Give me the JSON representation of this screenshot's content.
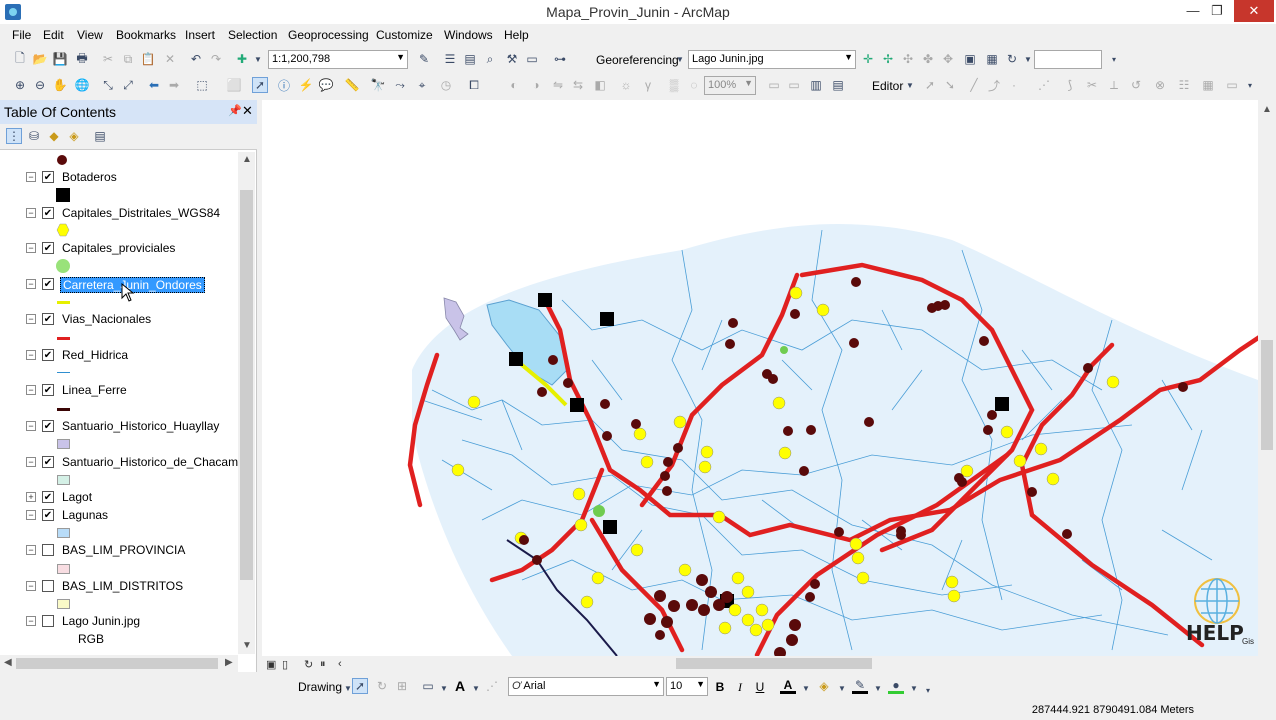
{
  "window": {
    "title": "Mapa_Provin_Junin - ArcMap",
    "minimize": "—",
    "restore": "❐",
    "close": "✕"
  },
  "menu": [
    "File",
    "Edit",
    "View",
    "Bookmarks",
    "Insert",
    "Selection",
    "Geoprocessing",
    "Customize",
    "Windows",
    "Help"
  ],
  "toolbar": {
    "scale": "1:1,200,798",
    "georeferencing_label": "Georeferencing",
    "georef_layer": "Lago Junin.jpg",
    "georef_extra": "",
    "editor_label": "Editor",
    "transparency": "100%"
  },
  "toc": {
    "title": "Table Of Contents",
    "layers": [
      {
        "name": "Botaderos",
        "checked": true,
        "symbol": "black-square"
      },
      {
        "name": "Capitales_Distritales_WGS84",
        "checked": true,
        "symbol": "yellow-hexagon"
      },
      {
        "name": "Capitales_proviciales",
        "checked": true,
        "symbol": "green-circle"
      },
      {
        "name": "Carretera_Junin_Ondores",
        "checked": true,
        "symbol": "yellow-line",
        "selected": true
      },
      {
        "name": "Vias_Nacionales",
        "checked": true,
        "symbol": "red-line"
      },
      {
        "name": "Red_Hidrica",
        "checked": true,
        "symbol": "blue-line"
      },
      {
        "name": "Linea_Ferre",
        "checked": true,
        "symbol": "dark-line"
      },
      {
        "name": "Santuario_Historico_Huayllay",
        "checked": true,
        "symbol": "lavender-fill"
      },
      {
        "name": "Santuario_Historico_de_Chacamarca",
        "checked": true,
        "symbol": "mint-fill"
      },
      {
        "name": "Lagot",
        "checked": true,
        "symbol": "none",
        "collapsed": true
      },
      {
        "name": "Lagunas",
        "checked": true,
        "symbol": "lightblue-fill"
      },
      {
        "name": "BAS_LIM_PROVINCIA",
        "checked": false,
        "symbol": "pink-fill"
      },
      {
        "name": "BAS_LIM_DISTRITOS",
        "checked": false,
        "symbol": "cream-fill"
      },
      {
        "name": "Lago Junin.jpg",
        "checked": false,
        "symbol": "none",
        "sub": "RGB"
      }
    ]
  },
  "draw": {
    "drawing_label": "Drawing",
    "font": "Arial",
    "size": "10",
    "bold": "B",
    "italic": "I",
    "underline": "U",
    "text_tool": "A"
  },
  "status": {
    "coords": "287444.921  8790491.084 Meters"
  },
  "logo": {
    "text": "HELP",
    "sub": "Gis"
  },
  "colors": {
    "roads": "#e02020",
    "rivers": "#2f8fd0",
    "capitals": "#ffff00",
    "dumps": "#000000",
    "points": "#5a0a0a"
  }
}
